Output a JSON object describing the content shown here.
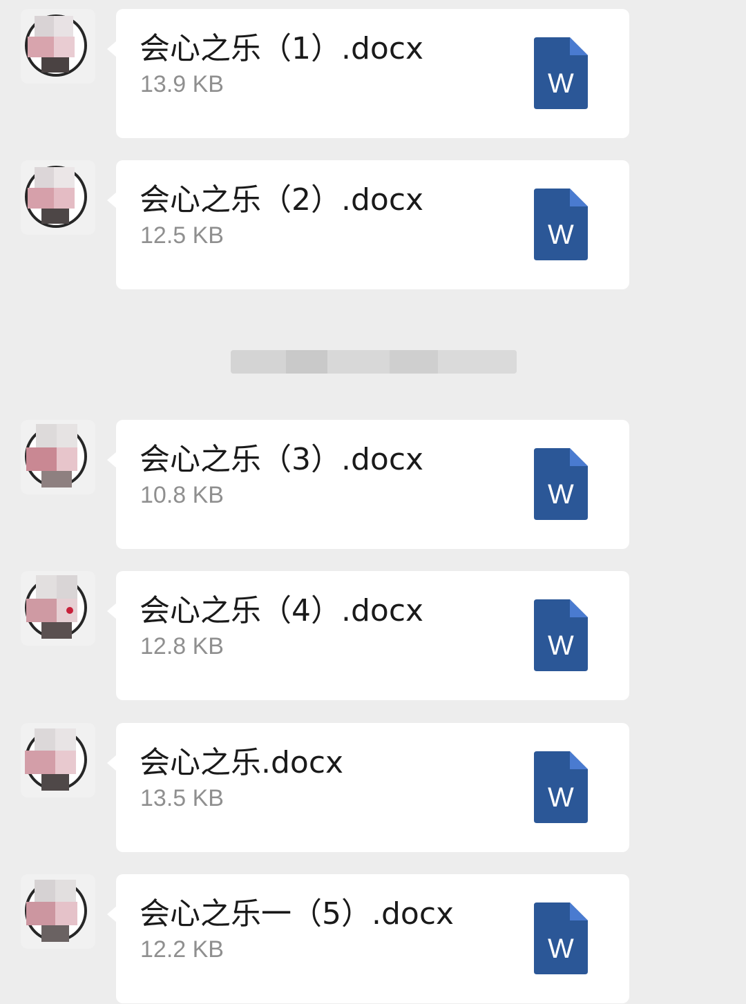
{
  "messages": [
    {
      "file_name": "会心之乐（1）.docx",
      "file_size": "13.9 KB",
      "icon": "word-doc-icon",
      "icon_letter": "W"
    },
    {
      "file_name": "会心之乐（2）.docx",
      "file_size": "12.5 KB",
      "icon": "word-doc-icon",
      "icon_letter": "W"
    },
    {
      "file_name": "会心之乐（3）.docx",
      "file_size": "10.8 KB",
      "icon": "word-doc-icon",
      "icon_letter": "W"
    },
    {
      "file_name": "会心之乐（4）.docx",
      "file_size": "12.8 KB",
      "icon": "word-doc-icon",
      "icon_letter": "W"
    },
    {
      "file_name": "会心之乐.docx",
      "file_size": "13.5 KB",
      "icon": "word-doc-icon",
      "icon_letter": "W"
    },
    {
      "file_name": "会心之乐一（5）.docx",
      "file_size": "12.2 KB",
      "icon": "word-doc-icon",
      "icon_letter": "W"
    }
  ],
  "colors": {
    "background": "#ededed",
    "bubble": "#ffffff",
    "word_blue": "#2b5797",
    "word_fold": "#4a7bd0",
    "file_name_text": "#1a1a1a",
    "file_size_text": "#8f8f8f"
  }
}
